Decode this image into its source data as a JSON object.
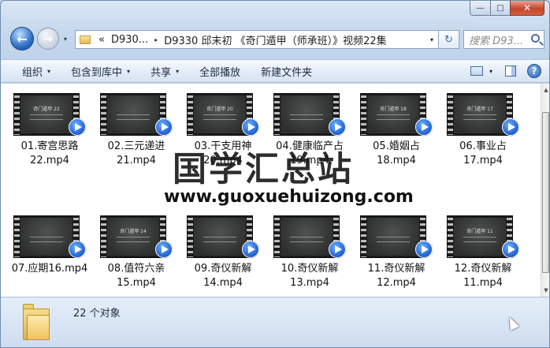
{
  "window": {
    "minimize_label": "—",
    "maximize_label": "□",
    "close_label": "✕"
  },
  "nav": {
    "back_icon": "back-arrow-icon",
    "forward_icon": "forward-arrow-icon",
    "back_glyph": "←",
    "forward_glyph": "→",
    "history_glyph": "▾"
  },
  "address": {
    "overflow": "«",
    "crumbs": [
      "D930...",
      "D9330 邱末初 《奇门遁甲（师承班）》视频22集"
    ],
    "separator": "▸",
    "dropdown": "▾"
  },
  "refresh": {
    "glyph": "↻"
  },
  "search": {
    "placeholder": "搜索 D93..."
  },
  "toolbar": {
    "organize": "组织",
    "include_in_library": "包含到库中",
    "share": "共享",
    "play_all": "全部播放",
    "new_folder": "新建文件夹",
    "arrow": "▾",
    "help": "?"
  },
  "files": [
    {
      "name": "01.寄宫思路22.mp4",
      "line1": "01.寄宫思路",
      "line2": "22.mp4",
      "cover": "奇门遁甲 22"
    },
    {
      "name": "02.三元递进21.mp4",
      "line1": "02.三元递进",
      "line2": "21.mp4",
      "cover": ""
    },
    {
      "name": "03.干支用神20.mp4",
      "line1": "03.干支用神",
      "line2": "20.mp4",
      "cover": "奇门遁甲 20"
    },
    {
      "name": "04.健康临产占19.mp4",
      "line1": "04.健康临产占",
      "line2": "19.mp4",
      "cover": ""
    },
    {
      "name": "05.婚姻占18.mp4",
      "line1": "05.婚姻占18.mp4",
      "line2": "",
      "cover": "奇门遁甲 18"
    },
    {
      "name": "06.事业占17.mp4",
      "line1": "06.事业占17.mp4",
      "line2": "",
      "cover": "奇门遁甲 17"
    },
    {
      "name": "07.应期16.mp4",
      "line1": "07.应期16.mp4",
      "line2": "",
      "cover": ""
    },
    {
      "name": "08.值符六亲15.mp4",
      "line1": "08.值符六亲",
      "line2": "15.mp4",
      "cover": "奇门遁甲 14"
    },
    {
      "name": "09.奇仪新解14.mp4",
      "line1": "09.奇仪新解",
      "line2": "14.mp4",
      "cover": ""
    },
    {
      "name": "10.奇仪新解13.mp4",
      "line1": "10.奇仪新解",
      "line2": "13.mp4",
      "cover": ""
    },
    {
      "name": "11.奇仪新解12.mp4",
      "line1": "11.奇仪新解",
      "line2": "12.mp4",
      "cover": ""
    },
    {
      "name": "12.奇仪新解11.mp4",
      "line1": "12.奇仪新解",
      "line2": "11.mp4",
      "cover": "奇门遁甲 11"
    }
  ],
  "watermark": {
    "text": "国学汇总站",
    "url": "www.guoxuehuizong.com"
  },
  "status": {
    "count_text": "22 个对象"
  },
  "scrollbar": {
    "up": "▲",
    "down": "▼"
  }
}
